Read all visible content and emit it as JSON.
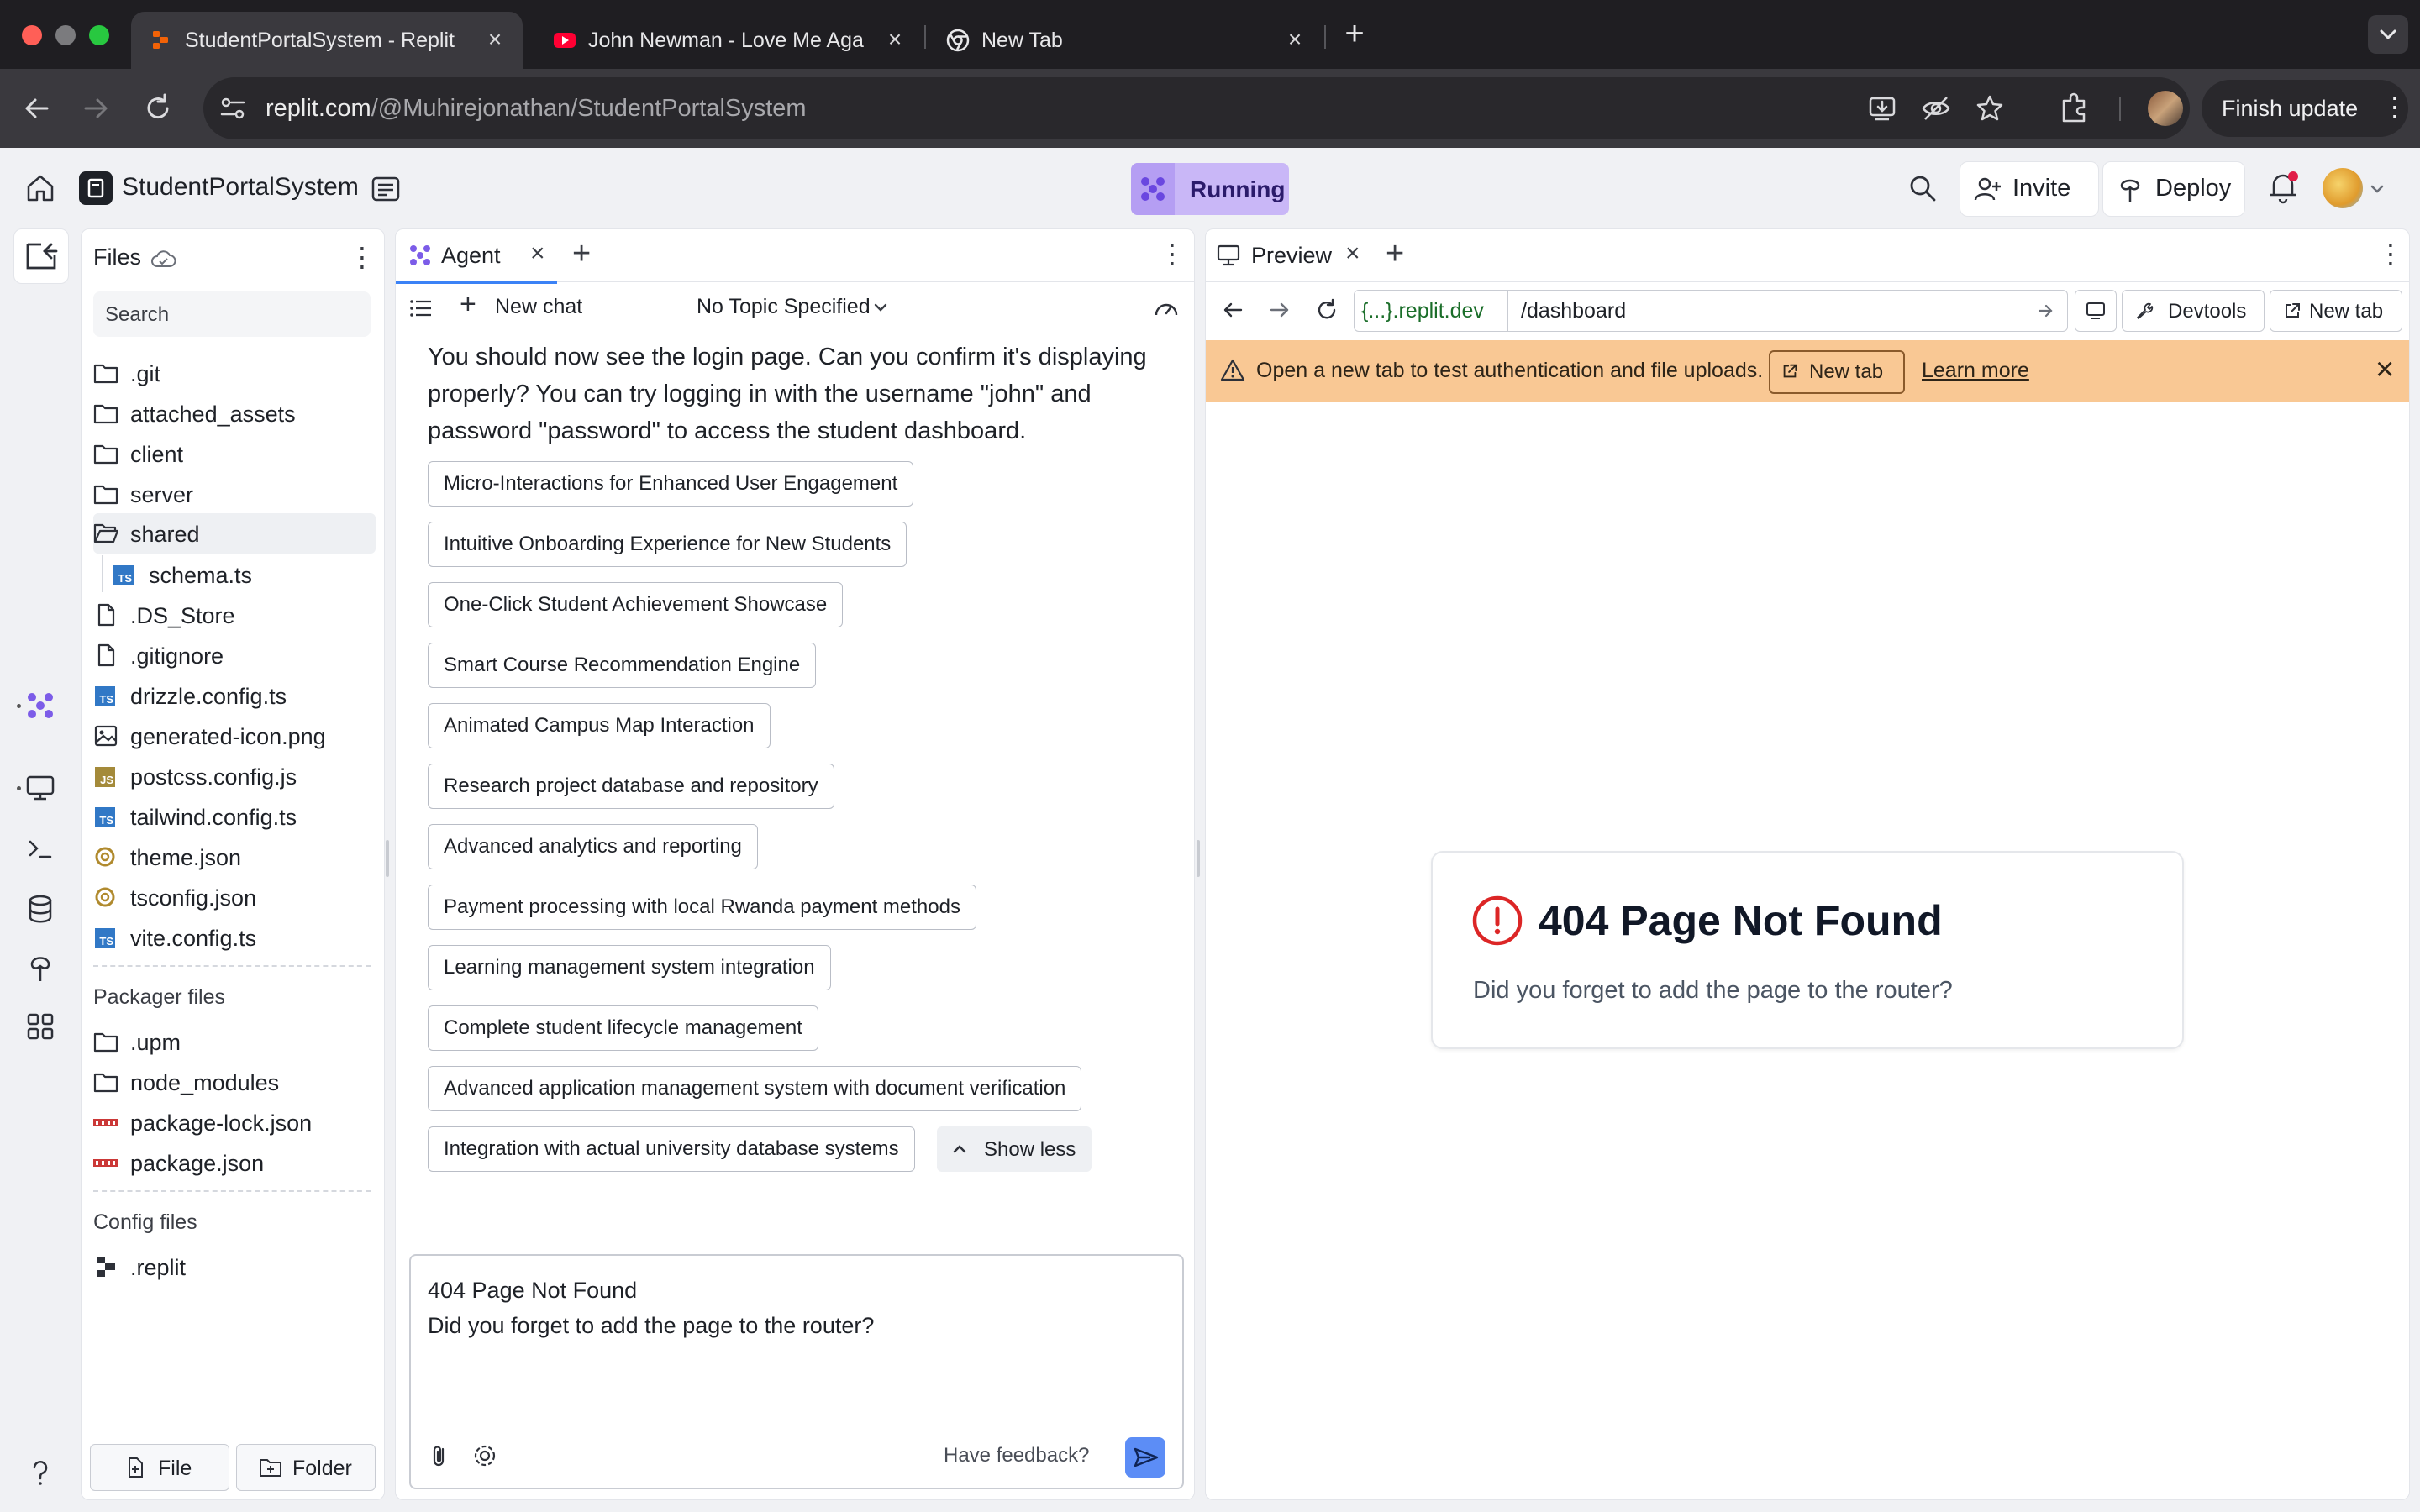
{
  "browser": {
    "tabs": [
      {
        "title": "StudentPortalSystem - Replit",
        "active": true
      },
      {
        "title": "John Newman - Love Me Again",
        "active": false
      },
      {
        "title": "New Tab",
        "active": false
      }
    ],
    "url_host": "replit.com",
    "url_path": "/@Muhirejonathan/StudentPortalSystem",
    "finish_update": "Finish update"
  },
  "header": {
    "project_name": "StudentPortalSystem",
    "run_status": "Running",
    "invite": "Invite",
    "deploy": "Deploy"
  },
  "files": {
    "title": "Files",
    "search_placeholder": "Search",
    "items": [
      {
        "name": ".git",
        "type": "folder"
      },
      {
        "name": "attached_assets",
        "type": "folder"
      },
      {
        "name": "client",
        "type": "folder"
      },
      {
        "name": "server",
        "type": "folder"
      },
      {
        "name": "shared",
        "type": "folder-open"
      },
      {
        "name": "schema.ts",
        "type": "ts"
      },
      {
        "name": ".DS_Store",
        "type": "file"
      },
      {
        "name": ".gitignore",
        "type": "file"
      },
      {
        "name": "drizzle.config.ts",
        "type": "ts"
      },
      {
        "name": "generated-icon.png",
        "type": "image"
      },
      {
        "name": "postcss.config.js",
        "type": "js"
      },
      {
        "name": "tailwind.config.ts",
        "type": "ts"
      },
      {
        "name": "theme.json",
        "type": "json"
      },
      {
        "name": "tsconfig.json",
        "type": "json"
      },
      {
        "name": "vite.config.ts",
        "type": "ts"
      }
    ],
    "packager_title": "Packager files",
    "packager_items": [
      {
        "name": ".upm",
        "type": "folder"
      },
      {
        "name": "node_modules",
        "type": "folder"
      },
      {
        "name": "package-lock.json",
        "type": "npm"
      },
      {
        "name": "package.json",
        "type": "npm"
      }
    ],
    "config_title": "Config files",
    "config_items": [
      {
        "name": ".replit",
        "type": "replit"
      }
    ],
    "new_file": "File",
    "new_folder": "Folder"
  },
  "agent": {
    "tab_label": "Agent",
    "new_chat": "New chat",
    "topic": "No Topic Specified",
    "message": "You should now see the login page. Can you confirm it's displaying properly? You can try logging in with the username \"john\" and password \"password\" to access the student dashboard.",
    "suggestions": [
      "Micro-Interactions for Enhanced User Engagement",
      "Intuitive Onboarding Experience for New Students",
      "One-Click Student Achievement Showcase",
      "Smart Course Recommendation Engine",
      "Animated Campus Map Interaction",
      "Research project database and repository",
      "Advanced analytics and reporting",
      "Payment processing with local Rwanda payment methods",
      "Learning management system integration",
      "Complete student lifecycle management",
      "Advanced application management system with document verification",
      "Integration with actual university database systems"
    ],
    "show_less": "Show less",
    "input_line1": "404 Page Not Found",
    "input_line2": "Did you forget to add the page to the router?",
    "feedback": "Have feedback?"
  },
  "preview": {
    "tab_label": "Preview",
    "url_domain": "{...}.replit.dev",
    "url_path": "/dashboard",
    "devtools": "Devtools",
    "new_tab": "New tab",
    "banner_text": "Open a new tab to test authentication and file uploads.",
    "banner_button": "New tab",
    "banner_link": "Learn more",
    "error_title": "404 Page Not Found",
    "error_message": "Did you forget to add the page to the router?"
  },
  "colors": {
    "running_bg": "#c9b7f7",
    "banner_bg": "#f9c894",
    "error_red": "#dc2626",
    "send_button": "#5c8df6"
  }
}
